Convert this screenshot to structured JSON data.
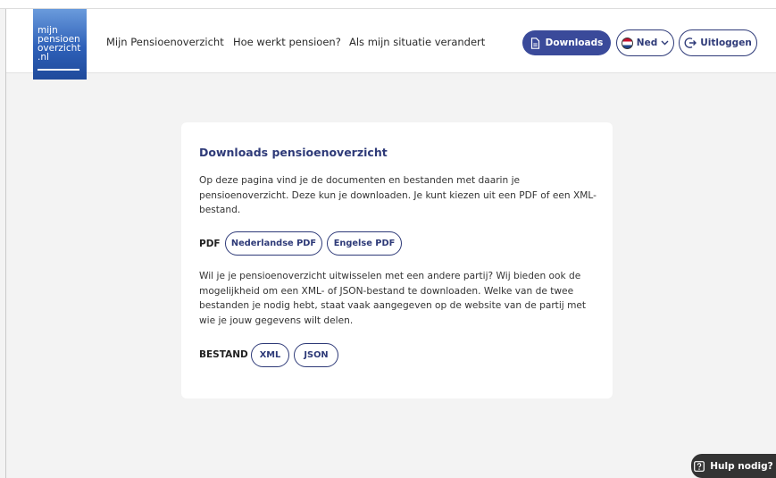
{
  "logo": {
    "lines": [
      "mijn",
      "pensioen",
      "overzicht",
      ".nl"
    ]
  },
  "nav": {
    "items": [
      {
        "label": "Mijn Pensioenoverzicht"
      },
      {
        "label": "Hoe werkt pensioen?"
      },
      {
        "label": "Als mijn situatie verandert"
      }
    ]
  },
  "header": {
    "downloads_label": "Downloads",
    "language_label": "Ned",
    "logout_label": "Uitloggen"
  },
  "card": {
    "title": "Downloads pensioenoverzicht",
    "intro": "Op deze pagina vind je de documenten en bestanden met daarin je pensioenoverzicht. Deze kun je downloaden. Je kunt kiezen uit een PDF of een XML-bestand.",
    "pdf_label": "PDF",
    "pdf_buttons": [
      "Nederlandse PDF",
      "Engelse PDF"
    ],
    "exchange_text": "Wil je je pensioenoverzicht uitwisselen met een andere partij? Wij bieden ook de mogelijkheid om een XML- of JSON-bestand te downloaden. Welke van de twee bestanden je nodig hebt, staat vaak aangegeven op de website van de partij met wie je jouw gegevens wilt delen.",
    "file_label": "BESTAND",
    "file_buttons": [
      "XML",
      "JSON"
    ]
  },
  "help": {
    "label": "Hulp nodig?"
  },
  "colors": {
    "primary": "#3a4a9a",
    "navy": "#2e3a78",
    "background": "#f3f3f3"
  }
}
